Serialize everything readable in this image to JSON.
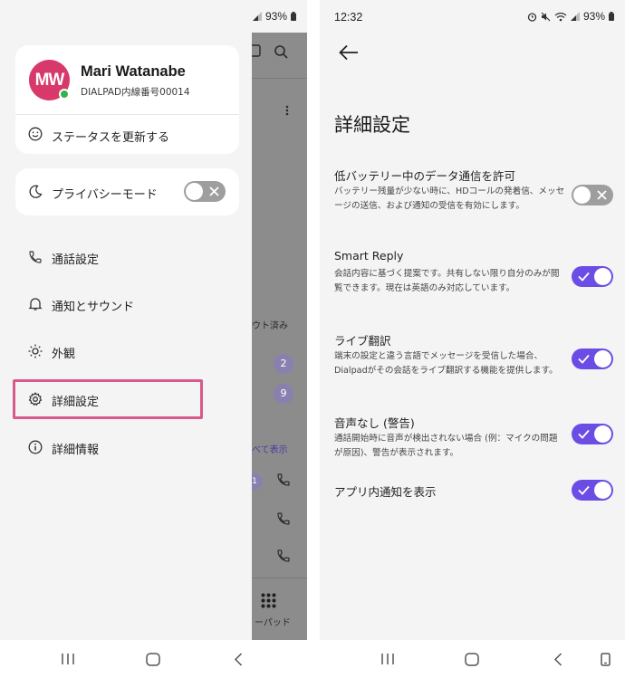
{
  "status_bar": {
    "time": "12:32",
    "battery": "93%"
  },
  "drawer": {
    "user": {
      "initials": "MW",
      "name": "Mari Watanabe",
      "extension": "DIALPAD内線番号00014",
      "presence_color": "#2fb54a",
      "avatar_color": "#d8396b"
    },
    "update_status_label": "ステータスを更新する",
    "privacy_mode": {
      "label": "プライバシーモード",
      "enabled": false
    },
    "menu": [
      {
        "label": "通話設定",
        "icon": "phone-icon"
      },
      {
        "label": "通知とサウンド",
        "icon": "bell-icon"
      },
      {
        "label": "外観",
        "icon": "sun-icon"
      },
      {
        "label": "詳細設定",
        "icon": "gear-icon",
        "highlighted": true
      },
      {
        "label": "詳細情報",
        "icon": "info-icon"
      }
    ]
  },
  "background_app": {
    "logged_out_text": "ウト済み",
    "badges": [
      "2",
      "9",
      "1"
    ],
    "show_all_link": "べて表示",
    "keypad_label": "ーパッド"
  },
  "advanced_settings": {
    "title": "詳細設定",
    "items": [
      {
        "title": "低バッテリー中のデータ通信を許可",
        "description": "バッテリー残量が少ない時に、HDコールの発着信、メッセージの送信、および通知の受信を有効にします。",
        "enabled": false
      },
      {
        "title": "Smart Reply",
        "description": "会話内容に基づく提案です。共有しない限り自分のみが閲覧できます。現在は英語のみ対応しています。",
        "enabled": true
      },
      {
        "title": "ライブ翻訳",
        "description": "端末の設定と違う言語でメッセージを受信した場合、Dialpadがその会話をライブ翻訳する機能を提供します。",
        "enabled": true
      },
      {
        "title": "音声なし (警告)",
        "description": "通話開始時に音声が検出されない場合 (例：マイクの問題が原因)、警告が表示されます。",
        "enabled": true
      },
      {
        "title": "アプリ内通知を表示",
        "description": "",
        "enabled": true
      }
    ]
  },
  "colors": {
    "accent": "#6b4de6",
    "highlight_border": "#d65a8c",
    "toggle_off": "#9e9e9e"
  }
}
